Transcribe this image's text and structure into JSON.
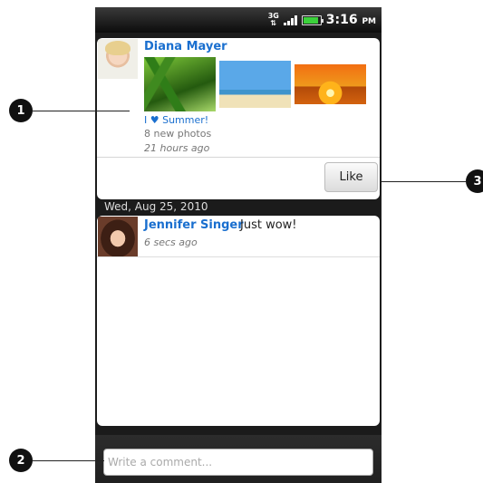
{
  "status_bar": {
    "network": "3G",
    "time": "3:16",
    "time_suffix": "PM",
    "battery_level": 0.8
  },
  "feed": {
    "photo_post": {
      "author": "Diana Mayer",
      "album_title": "I ♥ Summer!",
      "photo_count": "8 new photos",
      "timestamp": "21 hours ago",
      "like_label": "Like"
    },
    "date_header": "Wed, Aug 25, 2010",
    "status_post": {
      "author": "Jennifer Singer",
      "text": "Just wow!",
      "timestamp": "6 secs ago"
    }
  },
  "composer": {
    "placeholder": "Write a comment..."
  },
  "callouts": [
    "1",
    "2",
    "3"
  ],
  "colors": {
    "link_blue": "#1a6fcf",
    "callout_black": "#111111"
  },
  "icons": [
    "network-3g-icon",
    "signal-icon",
    "battery-icon"
  ]
}
